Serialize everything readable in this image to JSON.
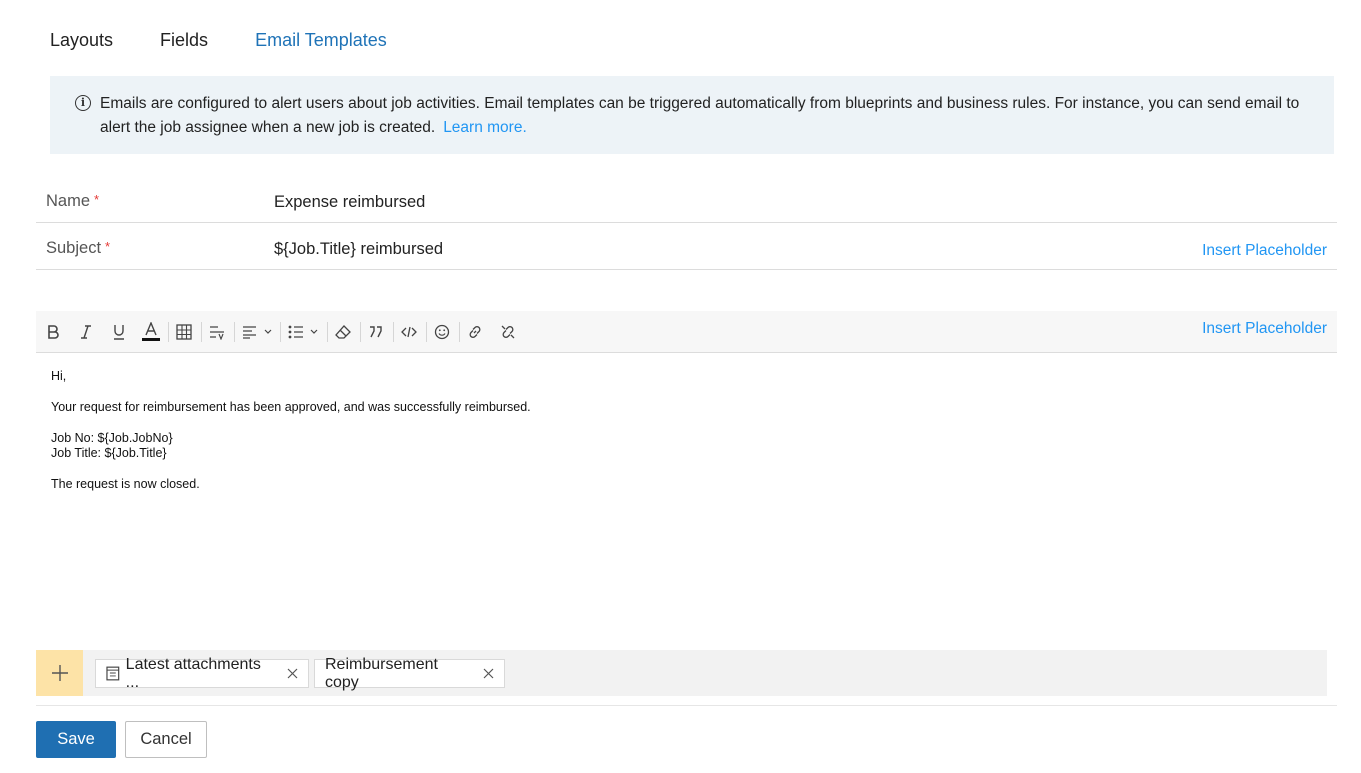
{
  "tabs": [
    {
      "label": "Layouts",
      "active": false
    },
    {
      "label": "Fields",
      "active": false
    },
    {
      "label": "Email Templates",
      "active": true
    }
  ],
  "info": {
    "icon": "info-icon",
    "text": "Emails are configured to alert users about job activities. Email templates can be triggered automatically from blueprints and business rules. For instance, you can send email to alert the job assignee when a new  job is created.",
    "link": "Learn more."
  },
  "form": {
    "name": {
      "label": "Name",
      "required_mark": "*",
      "value": "Expense reimbursed"
    },
    "subject": {
      "label": "Subject",
      "required_mark": "*",
      "value": "${Job.Title} reimbursed",
      "insert_link": "Insert Placeholder"
    }
  },
  "toolbar": {
    "insert_link": "Insert Placeholder",
    "tools": [
      "bold",
      "italic",
      "underline",
      "font-color",
      "table",
      "line-height",
      "align",
      "list",
      "clear-format",
      "blockquote",
      "code",
      "emoji",
      "link",
      "unlink"
    ]
  },
  "editor": {
    "greeting": "Hi,",
    "line1": "Your request for reimbursement has been approved, and was successfully reimbursed.",
    "line2": "Job No: ${Job.JobNo}",
    "line3": "Job Title: ${Job.Title}",
    "line4": "The request is now closed."
  },
  "attachments": [
    {
      "label": "Latest attachments ...",
      "icon": "document-icon"
    },
    {
      "label": "Reimbursement copy"
    }
  ],
  "buttons": {
    "save": "Save",
    "cancel": "Cancel"
  },
  "colors": {
    "accent": "#1f73b7",
    "link": "#2196f3",
    "required": "#e53935",
    "info_bg": "#edf3f7",
    "add_bg": "#fde3a7"
  }
}
